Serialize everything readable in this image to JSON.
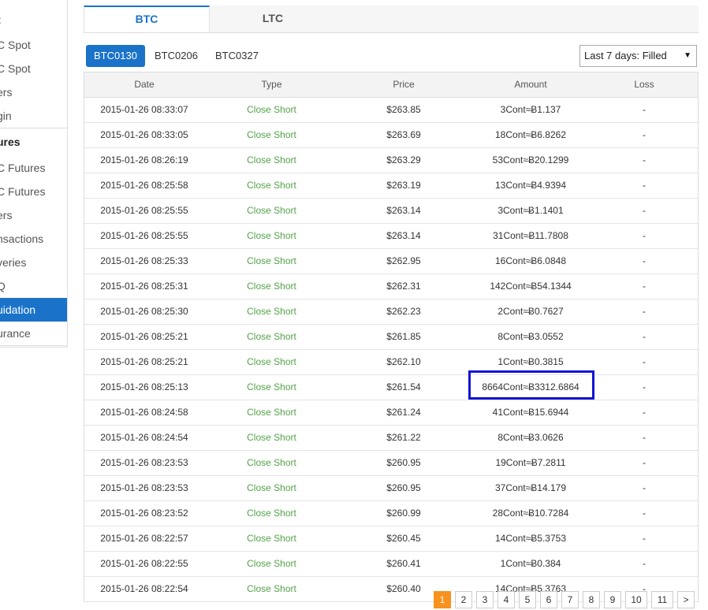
{
  "sidebar": {
    "items": [
      {
        "label": "t",
        "kind": "head"
      },
      {
        "label": "C Spot",
        "kind": "item"
      },
      {
        "label": "C Spot",
        "kind": "item"
      },
      {
        "label": "ers",
        "kind": "item"
      },
      {
        "label": "gin",
        "kind": "item"
      },
      {
        "label": "ures",
        "kind": "head"
      },
      {
        "label": "C Futures",
        "kind": "item"
      },
      {
        "label": "C Futures",
        "kind": "item"
      },
      {
        "label": "ers",
        "kind": "item"
      },
      {
        "label": "nsactions",
        "kind": "item"
      },
      {
        "label": "veries",
        "kind": "item"
      },
      {
        "label": "Q",
        "kind": "item"
      },
      {
        "label": "uidation",
        "kind": "active"
      },
      {
        "label": "urance",
        "kind": "item"
      }
    ]
  },
  "tabs": [
    {
      "label": "BTC",
      "active": true
    },
    {
      "label": "LTC",
      "active": false
    }
  ],
  "contracts": [
    {
      "label": "BTC0130",
      "active": true
    },
    {
      "label": "BTC0206",
      "active": false
    },
    {
      "label": "BTC0327",
      "active": false
    }
  ],
  "filter": {
    "selected": "Last 7 days: Filled",
    "arrow": "▼"
  },
  "table": {
    "headers": {
      "date": "Date",
      "type": "Type",
      "price": "Price",
      "amount": "Amount",
      "loss": "Loss"
    },
    "rows": [
      {
        "date": "2015-01-26 08:33:07",
        "type": "Close Short",
        "price": "$263.85",
        "amount": "3Cont≈Ƀ1.137",
        "loss": "-"
      },
      {
        "date": "2015-01-26 08:33:05",
        "type": "Close Short",
        "price": "$263.69",
        "amount": "18Cont≈Ƀ6.8262",
        "loss": "-"
      },
      {
        "date": "2015-01-26 08:26:19",
        "type": "Close Short",
        "price": "$263.29",
        "amount": "53Cont≈Ƀ20.1299",
        "loss": "-"
      },
      {
        "date": "2015-01-26 08:25:58",
        "type": "Close Short",
        "price": "$263.19",
        "amount": "13Cont≈Ƀ4.9394",
        "loss": "-"
      },
      {
        "date": "2015-01-26 08:25:55",
        "type": "Close Short",
        "price": "$263.14",
        "amount": "3Cont≈Ƀ1.1401",
        "loss": "-"
      },
      {
        "date": "2015-01-26 08:25:55",
        "type": "Close Short",
        "price": "$263.14",
        "amount": "31Cont≈Ƀ11.7808",
        "loss": "-"
      },
      {
        "date": "2015-01-26 08:25:33",
        "type": "Close Short",
        "price": "$262.95",
        "amount": "16Cont≈Ƀ6.0848",
        "loss": "-"
      },
      {
        "date": "2015-01-26 08:25:31",
        "type": "Close Short",
        "price": "$262.31",
        "amount": "142Cont≈Ƀ54.1344",
        "loss": "-"
      },
      {
        "date": "2015-01-26 08:25:30",
        "type": "Close Short",
        "price": "$262.23",
        "amount": "2Cont≈Ƀ0.7627",
        "loss": "-"
      },
      {
        "date": "2015-01-26 08:25:21",
        "type": "Close Short",
        "price": "$261.85",
        "amount": "8Cont≈Ƀ3.0552",
        "loss": "-"
      },
      {
        "date": "2015-01-26 08:25:21",
        "type": "Close Short",
        "price": "$262.10",
        "amount": "1Cont≈Ƀ0.3815",
        "loss": "-"
      },
      {
        "date": "2015-01-26 08:25:13",
        "type": "Close Short",
        "price": "$261.54",
        "amount": "8664Cont≈Ƀ3312.6864",
        "loss": "-",
        "highlight": true
      },
      {
        "date": "2015-01-26 08:24:58",
        "type": "Close Short",
        "price": "$261.24",
        "amount": "41Cont≈Ƀ15.6944",
        "loss": "-"
      },
      {
        "date": "2015-01-26 08:24:54",
        "type": "Close Short",
        "price": "$261.22",
        "amount": "8Cont≈Ƀ3.0626",
        "loss": "-"
      },
      {
        "date": "2015-01-26 08:23:53",
        "type": "Close Short",
        "price": "$260.95",
        "amount": "19Cont≈Ƀ7.2811",
        "loss": "-"
      },
      {
        "date": "2015-01-26 08:23:53",
        "type": "Close Short",
        "price": "$260.95",
        "amount": "37Cont≈Ƀ14.179",
        "loss": "-"
      },
      {
        "date": "2015-01-26 08:23:52",
        "type": "Close Short",
        "price": "$260.99",
        "amount": "28Cont≈Ƀ10.7284",
        "loss": "-"
      },
      {
        "date": "2015-01-26 08:22:57",
        "type": "Close Short",
        "price": "$260.45",
        "amount": "14Cont≈Ƀ5.3753",
        "loss": "-"
      },
      {
        "date": "2015-01-26 08:22:55",
        "type": "Close Short",
        "price": "$260.41",
        "amount": "1Cont≈Ƀ0.384",
        "loss": "-"
      },
      {
        "date": "2015-01-26 08:22:54",
        "type": "Close Short",
        "price": "$260.40",
        "amount": "14Cont≈Ƀ5.3763",
        "loss": "-"
      }
    ]
  },
  "pagination": {
    "pages": [
      "1",
      "2",
      "3",
      "4",
      "5",
      "6",
      "7",
      "8",
      "9",
      "10",
      "11"
    ],
    "current": "1",
    "next": ">"
  },
  "colors": {
    "accent": "#1a73c9",
    "type_green": "#52a447",
    "highlight_border": "#1313d3",
    "pager_active": "#f7921e"
  }
}
